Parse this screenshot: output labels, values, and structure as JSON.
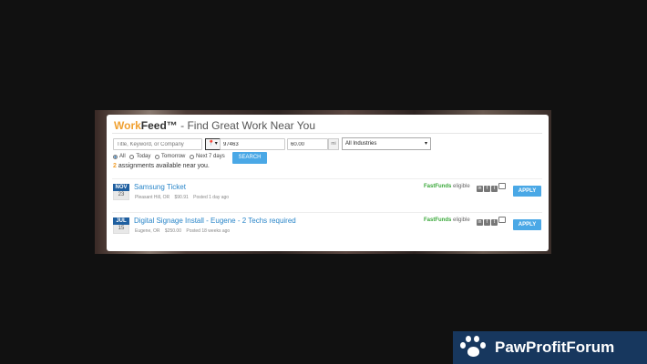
{
  "header": {
    "brand_work": "Work",
    "brand_feed": "Feed™",
    "tagline": " - Find Great Work Near You"
  },
  "search": {
    "keyword_placeholder": "Title, Keyword, or Company",
    "zip_value": "97463",
    "radius_value": "60.00",
    "radius_unit": "mi",
    "industry_selected": "All Industries",
    "search_label": "SEARCH",
    "date_filters": [
      {
        "label": "All",
        "selected": true
      },
      {
        "label": "Today",
        "selected": false
      },
      {
        "label": "Tomorrow",
        "selected": false
      },
      {
        "label": "Next 7 days",
        "selected": false
      }
    ]
  },
  "results": {
    "count": "2",
    "count_suffix": " assignments available near you."
  },
  "jobs": [
    {
      "month": "NOV",
      "day": "23",
      "title": "Samsung Ticket",
      "location": "Pleasant Hill, OR",
      "pay": "$90.91",
      "posted": "Posted 1 day ago",
      "fastfunds": "FastFunds",
      "eligible": " eligible",
      "apply_label": "APPLY"
    },
    {
      "month": "JUL",
      "day": "15",
      "title": "Digital Signage Install - Eugene - 2 Techs required",
      "location": "Eugene, OR",
      "pay": "$250.00",
      "posted": "Posted 18 weeks ago",
      "fastfunds": "FastFunds",
      "eligible": " eligible",
      "apply_label": "APPLY"
    }
  ],
  "share_icons": [
    "linkedin-icon",
    "facebook-icon",
    "twitter-icon",
    "email-icon"
  ],
  "watermark": {
    "text": "PawProfitForum"
  },
  "colors": {
    "brand_orange": "#f0a030",
    "link_blue": "#2a86c9",
    "button_blue": "#4aa8e6",
    "fastfunds_green": "#3aa83a",
    "date_badge": "#1f5fa0",
    "watermark_bg": "#17375e"
  }
}
